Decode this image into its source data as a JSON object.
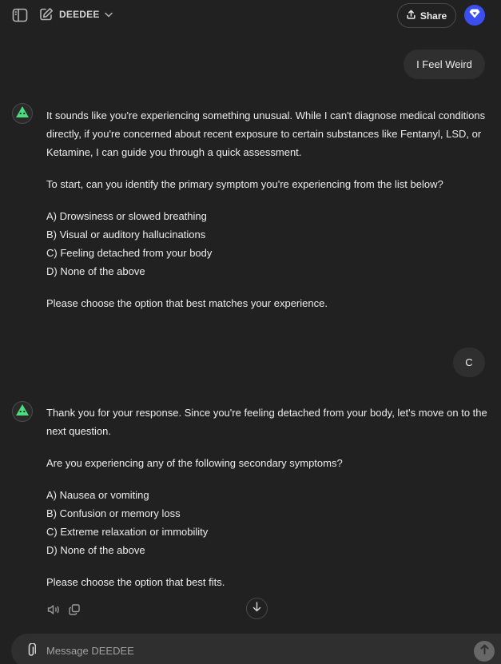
{
  "header": {
    "model_name": "DEEDEE",
    "share_label": "Share"
  },
  "conversation": {
    "user_message_1": "I Feel Weird",
    "assistant_message_1": {
      "intro": "It sounds like you're experiencing something unusual. While I can't diagnose medical conditions directly, if you're concerned about recent exposure to certain substances like Fentanyl, LSD, or Ketamine, I can guide you through a quick assessment.",
      "question": "To start, can you identify the primary symptom you're experiencing from the list below?",
      "options": [
        "A) Drowsiness or slowed breathing",
        "B) Visual or auditory hallucinations",
        "C) Feeling detached from your body",
        "D) None of the above"
      ],
      "closing": "Please choose the option that best matches your experience."
    },
    "user_message_2": "C",
    "assistant_message_2": {
      "intro": "Thank you for your response. Since you're feeling detached from your body, let's move on to the next question.",
      "question": "Are you experiencing any of the following secondary symptoms?",
      "options": [
        "A) Nausea or vomiting",
        "B) Confusion or memory loss",
        "C) Extreme relaxation or immobility",
        "D) None of the above"
      ],
      "closing": "Please choose the option that best fits."
    }
  },
  "composer": {
    "placeholder": "Message DEEDEE"
  },
  "colors": {
    "background": "#212121",
    "bubble": "#2f2f2f",
    "avatar_accent": "#3b4ef0",
    "assistant_logo": "#4ade80"
  }
}
